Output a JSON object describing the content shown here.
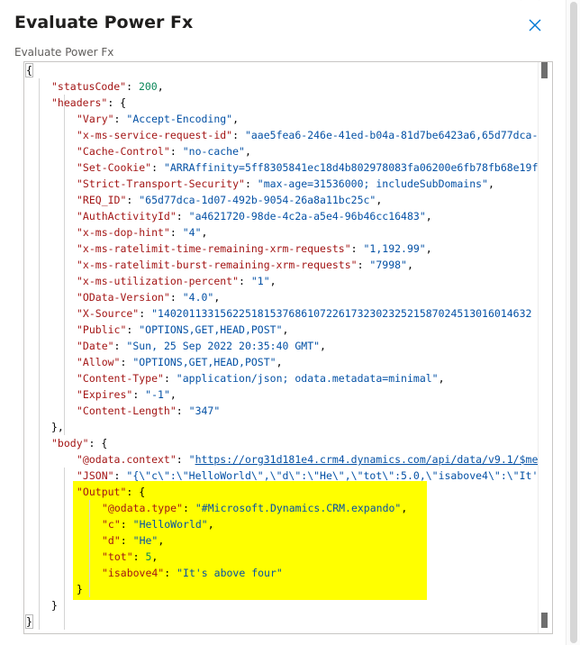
{
  "dialog": {
    "title": "Evaluate Power Fx",
    "field_label": "Evaluate Power Fx",
    "close_icon": "close-icon"
  },
  "editor": {
    "lines": [
      {
        "indent": 0,
        "tokens": [
          {
            "t": "{",
            "c": "p"
          }
        ]
      },
      {
        "indent": 1,
        "tokens": [
          {
            "t": "\"statusCode\"",
            "c": "k"
          },
          {
            "t": ": ",
            "c": "p"
          },
          {
            "t": "200",
            "c": "n"
          },
          {
            "t": ",",
            "c": "p"
          }
        ]
      },
      {
        "indent": 1,
        "tokens": [
          {
            "t": "\"headers\"",
            "c": "k"
          },
          {
            "t": ": {",
            "c": "p"
          }
        ]
      },
      {
        "indent": 2,
        "tokens": [
          {
            "t": "\"Vary\"",
            "c": "k"
          },
          {
            "t": ": ",
            "c": "p"
          },
          {
            "t": "\"Accept-Encoding\"",
            "c": "s"
          },
          {
            "t": ",",
            "c": "p"
          }
        ]
      },
      {
        "indent": 2,
        "tokens": [
          {
            "t": "\"x-ms-service-request-id\"",
            "c": "k"
          },
          {
            "t": ": ",
            "c": "p"
          },
          {
            "t": "\"aae5fea6-246e-41ed-b04a-81d7be6423a6,65d77dca-",
            "c": "s"
          }
        ]
      },
      {
        "indent": 2,
        "tokens": [
          {
            "t": "\"Cache-Control\"",
            "c": "k"
          },
          {
            "t": ": ",
            "c": "p"
          },
          {
            "t": "\"no-cache\"",
            "c": "s"
          },
          {
            "t": ",",
            "c": "p"
          }
        ]
      },
      {
        "indent": 2,
        "tokens": [
          {
            "t": "\"Set-Cookie\"",
            "c": "k"
          },
          {
            "t": ": ",
            "c": "p"
          },
          {
            "t": "\"ARRAffinity=5ff8305841ec18d4b802978083fa06200e6fb78fb68e19f",
            "c": "s"
          }
        ]
      },
      {
        "indent": 2,
        "tokens": [
          {
            "t": "\"Strict-Transport-Security\"",
            "c": "k"
          },
          {
            "t": ": ",
            "c": "p"
          },
          {
            "t": "\"max-age=31536000; includeSubDomains\"",
            "c": "s"
          },
          {
            "t": ",",
            "c": "p"
          }
        ]
      },
      {
        "indent": 2,
        "tokens": [
          {
            "t": "\"REQ_ID\"",
            "c": "k"
          },
          {
            "t": ": ",
            "c": "p"
          },
          {
            "t": "\"65d77dca-1d07-492b-9054-26a8a11bc25c\"",
            "c": "s"
          },
          {
            "t": ",",
            "c": "p"
          }
        ]
      },
      {
        "indent": 2,
        "tokens": [
          {
            "t": "\"AuthActivityId\"",
            "c": "k"
          },
          {
            "t": ": ",
            "c": "p"
          },
          {
            "t": "\"a4621720-98de-4c2a-a5e4-96b46cc16483\"",
            "c": "s"
          },
          {
            "t": ",",
            "c": "p"
          }
        ]
      },
      {
        "indent": 2,
        "tokens": [
          {
            "t": "\"x-ms-dop-hint\"",
            "c": "k"
          },
          {
            "t": ": ",
            "c": "p"
          },
          {
            "t": "\"4\"",
            "c": "s"
          },
          {
            "t": ",",
            "c": "p"
          }
        ]
      },
      {
        "indent": 2,
        "tokens": [
          {
            "t": "\"x-ms-ratelimit-time-remaining-xrm-requests\"",
            "c": "k"
          },
          {
            "t": ": ",
            "c": "p"
          },
          {
            "t": "\"1,192.99\"",
            "c": "s"
          },
          {
            "t": ",",
            "c": "p"
          }
        ]
      },
      {
        "indent": 2,
        "tokens": [
          {
            "t": "\"x-ms-ratelimit-burst-remaining-xrm-requests\"",
            "c": "k"
          },
          {
            "t": ": ",
            "c": "p"
          },
          {
            "t": "\"7998\"",
            "c": "s"
          },
          {
            "t": ",",
            "c": "p"
          }
        ]
      },
      {
        "indent": 2,
        "tokens": [
          {
            "t": "\"x-ms-utilization-percent\"",
            "c": "k"
          },
          {
            "t": ": ",
            "c": "p"
          },
          {
            "t": "\"1\"",
            "c": "s"
          },
          {
            "t": ",",
            "c": "p"
          }
        ]
      },
      {
        "indent": 2,
        "tokens": [
          {
            "t": "\"OData-Version\"",
            "c": "k"
          },
          {
            "t": ": ",
            "c": "p"
          },
          {
            "t": "\"4.0\"",
            "c": "s"
          },
          {
            "t": ",",
            "c": "p"
          }
        ]
      },
      {
        "indent": 2,
        "tokens": [
          {
            "t": "\"X-Source\"",
            "c": "k"
          },
          {
            "t": ": ",
            "c": "p"
          },
          {
            "t": "\"140201133156225181537686107226173230232521587024513016014632",
            "c": "s"
          }
        ]
      },
      {
        "indent": 2,
        "tokens": [
          {
            "t": "\"Public\"",
            "c": "k"
          },
          {
            "t": ": ",
            "c": "p"
          },
          {
            "t": "\"OPTIONS,GET,HEAD,POST\"",
            "c": "s"
          },
          {
            "t": ",",
            "c": "p"
          }
        ]
      },
      {
        "indent": 2,
        "tokens": [
          {
            "t": "\"Date\"",
            "c": "k"
          },
          {
            "t": ": ",
            "c": "p"
          },
          {
            "t": "\"Sun, 25 Sep 2022 20:35:40 GMT\"",
            "c": "s"
          },
          {
            "t": ",",
            "c": "p"
          }
        ]
      },
      {
        "indent": 2,
        "tokens": [
          {
            "t": "\"Allow\"",
            "c": "k"
          },
          {
            "t": ": ",
            "c": "p"
          },
          {
            "t": "\"OPTIONS,GET,HEAD,POST\"",
            "c": "s"
          },
          {
            "t": ",",
            "c": "p"
          }
        ]
      },
      {
        "indent": 2,
        "tokens": [
          {
            "t": "\"Content-Type\"",
            "c": "k"
          },
          {
            "t": ": ",
            "c": "p"
          },
          {
            "t": "\"application/json; odata.metadata=minimal\"",
            "c": "s"
          },
          {
            "t": ",",
            "c": "p"
          }
        ]
      },
      {
        "indent": 2,
        "tokens": [
          {
            "t": "\"Expires\"",
            "c": "k"
          },
          {
            "t": ": ",
            "c": "p"
          },
          {
            "t": "\"-1\"",
            "c": "s"
          },
          {
            "t": ",",
            "c": "p"
          }
        ]
      },
      {
        "indent": 2,
        "tokens": [
          {
            "t": "\"Content-Length\"",
            "c": "k"
          },
          {
            "t": ": ",
            "c": "p"
          },
          {
            "t": "\"347\"",
            "c": "s"
          }
        ]
      },
      {
        "indent": 1,
        "tokens": [
          {
            "t": "},",
            "c": "p"
          }
        ]
      },
      {
        "indent": 1,
        "tokens": [
          {
            "t": "\"body\"",
            "c": "k"
          },
          {
            "t": ": {",
            "c": "p"
          }
        ]
      },
      {
        "indent": 2,
        "tokens": [
          {
            "t": "\"@odata.context\"",
            "c": "k"
          },
          {
            "t": ": ",
            "c": "p"
          },
          {
            "t": "\"",
            "c": "s"
          },
          {
            "t": "https://org31d181e4.crm4.dynamics.com/api/data/v9.1/$me",
            "c": "u"
          }
        ]
      },
      {
        "indent": 2,
        "tokens": [
          {
            "t": "\"JSON\"",
            "c": "k"
          },
          {
            "t": ": ",
            "c": "p"
          },
          {
            "t": "\"{\\\"c\\\":\\\"HelloWorld\\\",\\\"d\\\":\\\"He\\\",\\\"tot\\\":5.0,\\\"isabove4\\\":\\\"It'",
            "c": "s"
          }
        ]
      },
      {
        "indent": 2,
        "tokens": [
          {
            "t": "\"Output\"",
            "c": "k"
          },
          {
            "t": ": {",
            "c": "p"
          }
        ]
      },
      {
        "indent": 3,
        "tokens": [
          {
            "t": "\"@odata.type\"",
            "c": "k"
          },
          {
            "t": ": ",
            "c": "p"
          },
          {
            "t": "\"#Microsoft.Dynamics.CRM.expando\"",
            "c": "s"
          },
          {
            "t": ",",
            "c": "p"
          }
        ]
      },
      {
        "indent": 3,
        "tokens": [
          {
            "t": "\"c\"",
            "c": "k"
          },
          {
            "t": ": ",
            "c": "p"
          },
          {
            "t": "\"HelloWorld\"",
            "c": "s"
          },
          {
            "t": ",",
            "c": "p"
          }
        ]
      },
      {
        "indent": 3,
        "tokens": [
          {
            "t": "\"d\"",
            "c": "k"
          },
          {
            "t": ": ",
            "c": "p"
          },
          {
            "t": "\"He\"",
            "c": "s"
          },
          {
            "t": ",",
            "c": "p"
          }
        ]
      },
      {
        "indent": 3,
        "tokens": [
          {
            "t": "\"tot\"",
            "c": "k"
          },
          {
            "t": ": ",
            "c": "p"
          },
          {
            "t": "5",
            "c": "n"
          },
          {
            "t": ",",
            "c": "p"
          }
        ]
      },
      {
        "indent": 3,
        "tokens": [
          {
            "t": "\"isabove4\"",
            "c": "k"
          },
          {
            "t": ": ",
            "c": "p"
          },
          {
            "t": "\"It's above four\"",
            "c": "s"
          }
        ]
      },
      {
        "indent": 2,
        "tokens": [
          {
            "t": "}",
            "c": "p"
          }
        ]
      },
      {
        "indent": 1,
        "tokens": [
          {
            "t": "}",
            "c": "p"
          }
        ]
      },
      {
        "indent": 0,
        "tokens": [
          {
            "t": "}",
            "c": "p"
          }
        ]
      }
    ]
  },
  "colors": {
    "highlight": "#ffff00",
    "close_icon": "#0078d4",
    "json_key": "#a31515",
    "json_string": "#0451a5",
    "json_number": "#098658"
  }
}
